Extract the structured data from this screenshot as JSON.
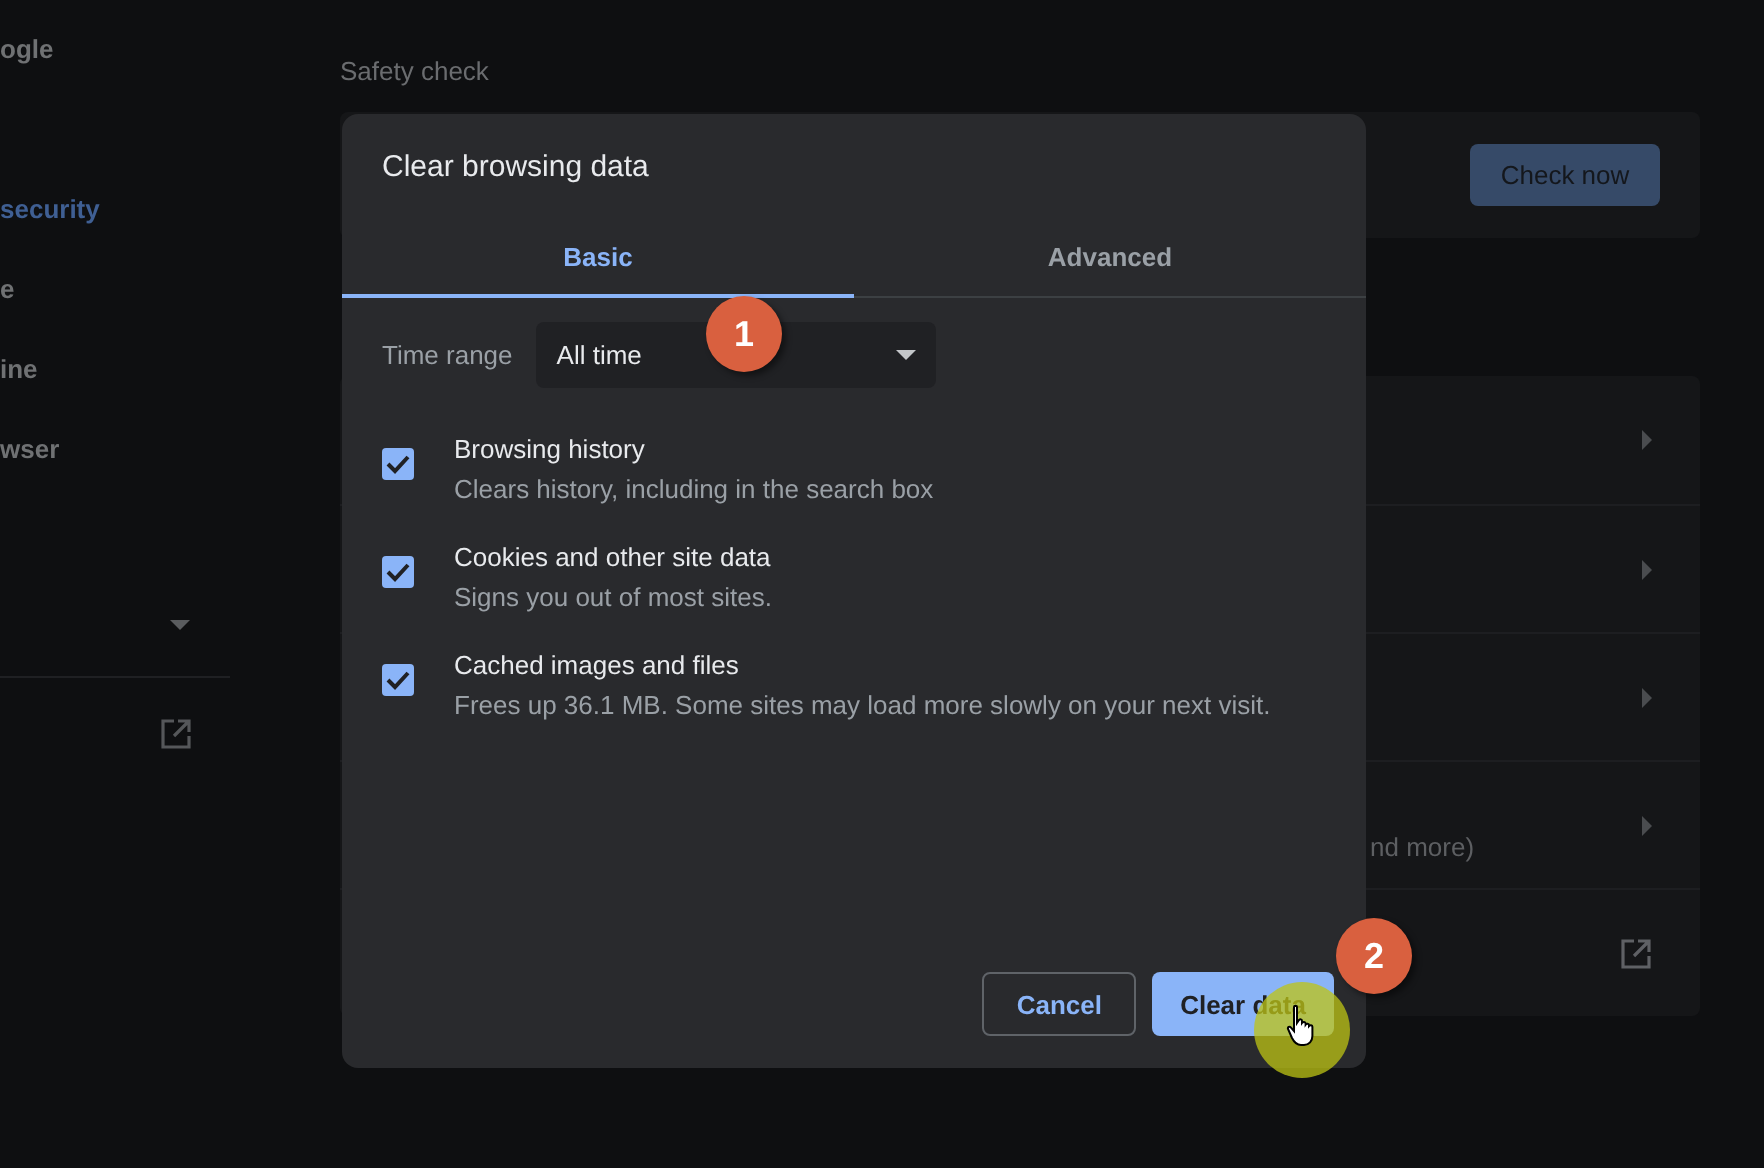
{
  "sidebar": {
    "items": [
      {
        "label": "ogle",
        "selected": false
      },
      {
        "label": "security",
        "selected": true
      },
      {
        "label": "e",
        "selected": false
      },
      {
        "label": "ine",
        "selected": false
      },
      {
        "label": "wser",
        "selected": false
      }
    ]
  },
  "main": {
    "section_title": "Safety check",
    "safety_button": "Check now",
    "rows": [
      {
        "kind": "arrow"
      },
      {
        "kind": "arrow"
      },
      {
        "kind": "arrow"
      },
      {
        "kind": "arrow",
        "text": "nd more)"
      },
      {
        "kind": "external"
      }
    ]
  },
  "dialog": {
    "title": "Clear browsing data",
    "tabs": [
      {
        "label": "Basic",
        "selected": true
      },
      {
        "label": "Advanced",
        "selected": false
      }
    ],
    "time_range": {
      "label": "Time range",
      "value": "All time"
    },
    "options": [
      {
        "title": "Browsing history",
        "description": "Clears history, including in the search box",
        "checked": true
      },
      {
        "title": "Cookies and other site data",
        "description": "Signs you out of most sites.",
        "checked": true
      },
      {
        "title": "Cached images and files",
        "description": "Frees up 36.1 MB. Some sites may load more slowly on your next visit.",
        "checked": true
      }
    ],
    "buttons": [
      {
        "label": "Cancel",
        "kind": "secondary"
      },
      {
        "label": "Clear data",
        "kind": "primary"
      }
    ]
  },
  "annotations": [
    {
      "label": "1"
    },
    {
      "label": "2"
    }
  ]
}
